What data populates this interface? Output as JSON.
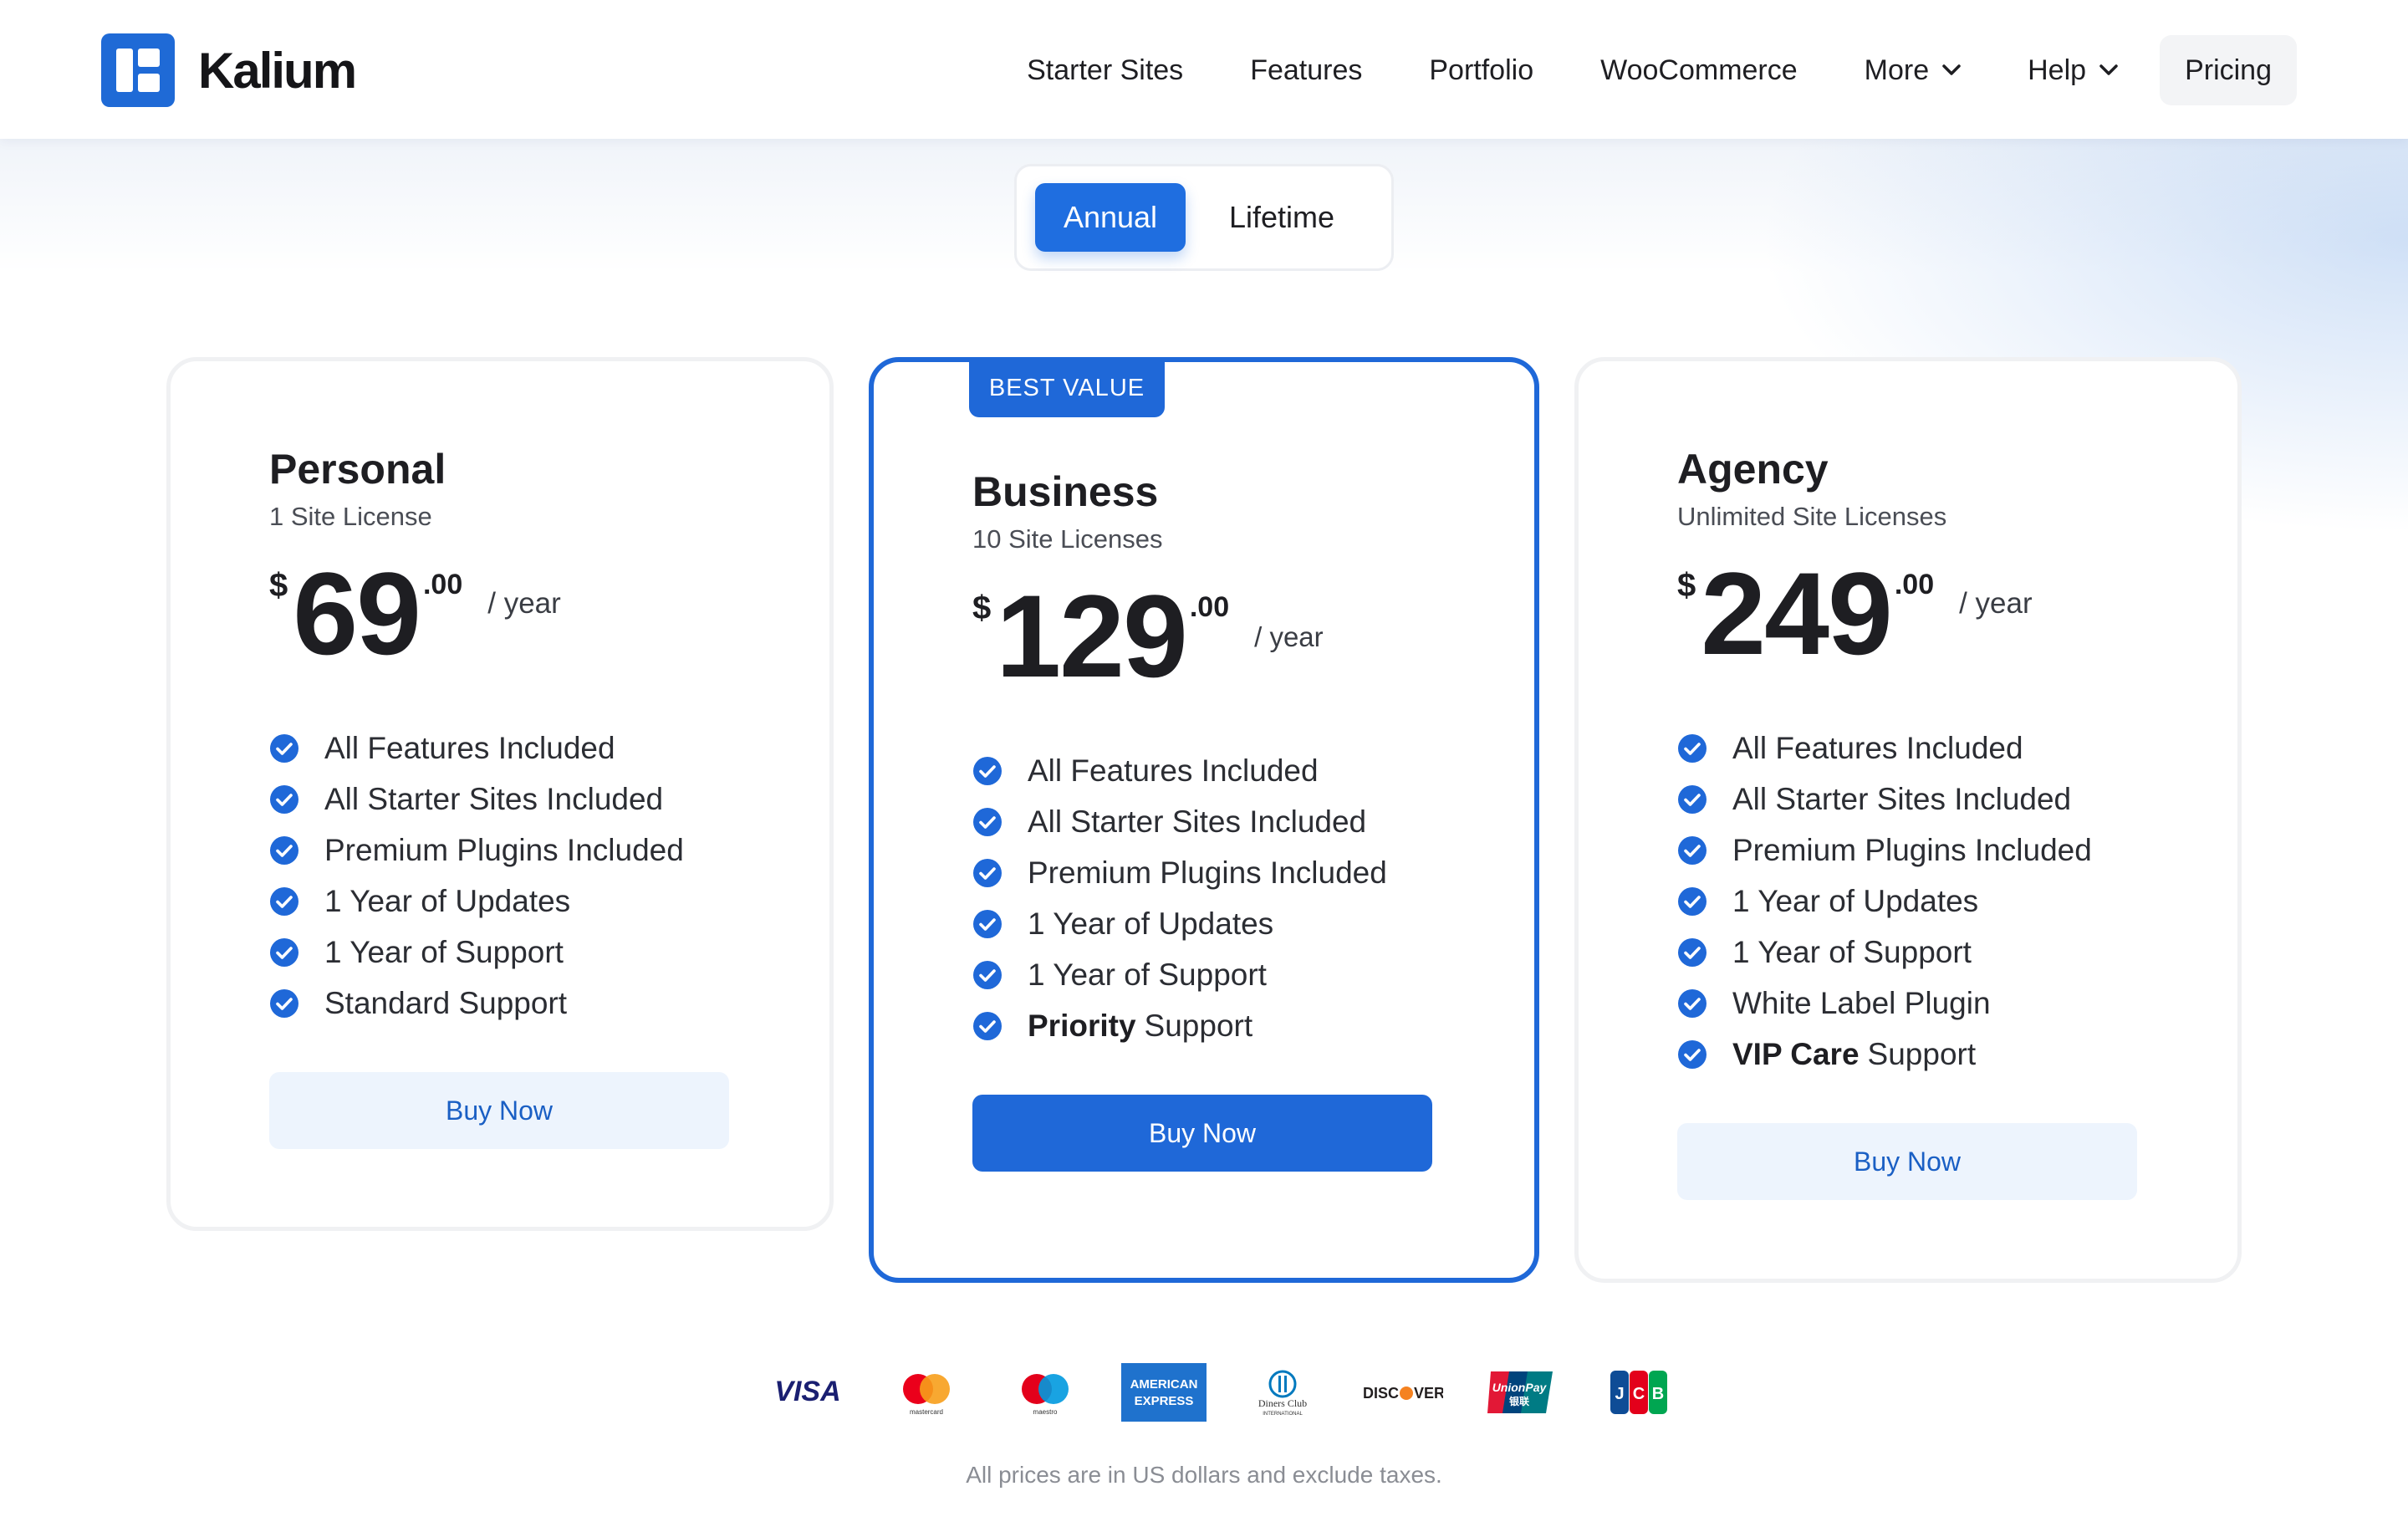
{
  "brand": {
    "name": "Kalium",
    "accent": "#1f68d8"
  },
  "nav": {
    "items": [
      {
        "label": "Starter Sites"
      },
      {
        "label": "Features"
      },
      {
        "label": "Portfolio"
      },
      {
        "label": "WooCommerce"
      },
      {
        "label": "More",
        "dropdown": true
      },
      {
        "label": "Help",
        "dropdown": true
      },
      {
        "label": "Pricing",
        "active": true
      }
    ]
  },
  "billing_toggle": {
    "options": [
      "Annual",
      "Lifetime"
    ],
    "selected": "Annual"
  },
  "plans": [
    {
      "name": "Personal",
      "subtitle": "1 Site License",
      "currency": "$",
      "amount": "69",
      "cents": ".00",
      "period": "/ year",
      "features": [
        {
          "text": "All Features Included"
        },
        {
          "text": "All Starter Sites Included"
        },
        {
          "text": "Premium Plugins Included"
        },
        {
          "text": "1 Year of Updates"
        },
        {
          "text": "1 Year of Support"
        },
        {
          "text": "Standard Support"
        }
      ],
      "cta": "Buy Now"
    },
    {
      "name": "Business",
      "badge": "BEST VALUE",
      "subtitle": "10 Site Licenses",
      "currency": "$",
      "amount": "129",
      "cents": ".00",
      "period": "/ year",
      "features": [
        {
          "text": "All Features Included"
        },
        {
          "text": "All Starter Sites Included"
        },
        {
          "text": "Premium Plugins Included"
        },
        {
          "text": "1 Year of Updates"
        },
        {
          "text": "1 Year of Support"
        },
        {
          "bold": "Priority",
          "text": "Support"
        }
      ],
      "cta": "Buy Now"
    },
    {
      "name": "Agency",
      "subtitle": "Unlimited Site Licenses",
      "currency": "$",
      "amount": "249",
      "cents": ".00",
      "period": "/ year",
      "features": [
        {
          "text": "All Features Included"
        },
        {
          "text": "All Starter Sites Included"
        },
        {
          "text": "Premium Plugins Included"
        },
        {
          "text": "1 Year of Updates"
        },
        {
          "text": "1 Year of Support"
        },
        {
          "text": "White Label Plugin"
        },
        {
          "bold": "VIP Care",
          "text": "Support"
        }
      ],
      "cta": "Buy Now"
    }
  ],
  "payment_methods": [
    {
      "icon": "visa-icon",
      "label": "VISA"
    },
    {
      "icon": "mastercard-icon",
      "label": "mastercard"
    },
    {
      "icon": "maestro-icon",
      "label": "maestro"
    },
    {
      "icon": "american-express-icon",
      "label": "AMERICAN EXPRESS"
    },
    {
      "icon": "diners-club-icon",
      "label": "Diners Club INTERNATIONAL"
    },
    {
      "icon": "discover-icon",
      "label": "DISCOVER"
    },
    {
      "icon": "unionpay-icon",
      "label": "UnionPay 银联"
    },
    {
      "icon": "jcb-icon",
      "label": "JCB"
    }
  ],
  "footer_note": "All prices are in US dollars and exclude taxes."
}
